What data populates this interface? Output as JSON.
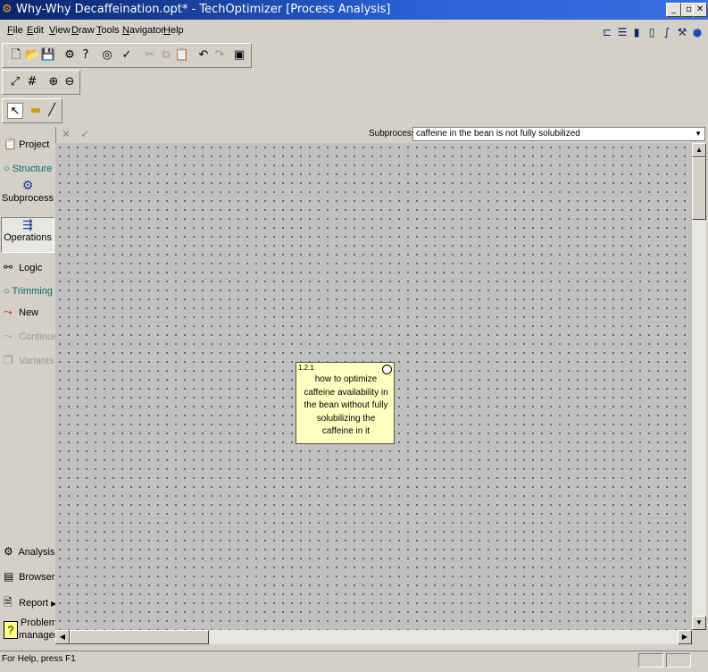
{
  "window": {
    "title": "Why-Why Decaffeination.opt* - TechOptimizer [Process Analysis]"
  },
  "menu": [
    "File",
    "Edit",
    "View",
    "Draw",
    "Tools",
    "Navigator",
    "Help"
  ],
  "toolbar": {
    "buttons": [
      "new",
      "open",
      "save",
      "properties",
      "help",
      "spell-check",
      "check",
      "cut",
      "copy",
      "paste",
      "undo",
      "redo",
      "fullscreen"
    ],
    "view_buttons": [
      "fit",
      "grid",
      "zoom-in",
      "zoom-out"
    ],
    "draw_buttons": [
      "select",
      "connector",
      "line"
    ]
  },
  "subprocess": {
    "label": "Subprocess",
    "value": "caffeine in the bean is not fully solubilized",
    "cancel_glyph": "✕",
    "ok_glyph": "✓"
  },
  "sidebar": {
    "project": "Project",
    "structure": "Structure",
    "subprocess": "Subprocess",
    "operations": "Operations",
    "logic": "Logic",
    "trimming": "Trimming",
    "new": "New",
    "continue": "Continue",
    "variants": "Variants",
    "analysis": "Analysis",
    "browser": "Browser",
    "report": "Report",
    "problem_manager_1": "Problem",
    "problem_manager_2": "manager"
  },
  "card": {
    "number": "1.2.1",
    "text": "how to optimize caffeine availability in the bean without fully solubilizing the caffeine in it"
  },
  "status": {
    "text": "For Help, press F1"
  }
}
